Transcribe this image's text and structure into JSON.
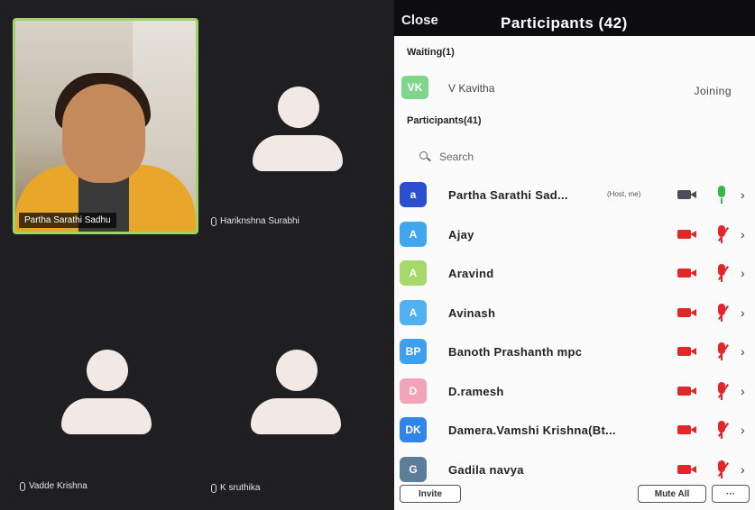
{
  "video": {
    "self_name": "Partha Sarathi Sadhu",
    "tiles": [
      {
        "name": "Hariknshna Surabhi"
      },
      {
        "name": "Vadde  Krishna"
      },
      {
        "name": "K sruthika"
      }
    ]
  },
  "panel": {
    "close_label": "Close",
    "title": "Participants (42)",
    "waiting_label": "Waiting(1)",
    "waiting": {
      "initials": "VK",
      "name": "V Kavitha",
      "status": "Joining",
      "color": "#7fd68a"
    },
    "participants_label": "Participants(41)",
    "search_placeholder": "Search",
    "participants": [
      {
        "initials": "a",
        "name": "Partha Sarathi Sad...",
        "tag": "(Host, me)",
        "color": "#2a4fd0",
        "video": "on",
        "audio": "live"
      },
      {
        "initials": "A",
        "name": "Ajay",
        "tag": "",
        "color": "#3fa6f0",
        "video": "off",
        "audio": "muted"
      },
      {
        "initials": "A",
        "name": "Aravind",
        "tag": "",
        "color": "#a6d86a",
        "video": "off",
        "audio": "muted"
      },
      {
        "initials": "A",
        "name": "Avinash",
        "tag": "",
        "color": "#4fb0f2",
        "video": "off",
        "audio": "muted"
      },
      {
        "initials": "BP",
        "name": "Banoth Prashanth mpc",
        "tag": "",
        "color": "#3e9ff0",
        "video": "off",
        "audio": "muted"
      },
      {
        "initials": "D",
        "name": "D.ramesh",
        "tag": "",
        "color": "#f3a3b8",
        "video": "off",
        "audio": "muted"
      },
      {
        "initials": "DK",
        "name": "Damera.Vamshi Krishna(Bt...",
        "tag": "",
        "color": "#2f86e8",
        "video": "off",
        "audio": "muted"
      },
      {
        "initials": "G",
        "name": "Gadila navya",
        "tag": "",
        "color": "#5c7e9a",
        "video": "off",
        "audio": "muted"
      }
    ],
    "invite_label": "Invite",
    "mute_all_label": "Mute All",
    "more_label": "···"
  }
}
